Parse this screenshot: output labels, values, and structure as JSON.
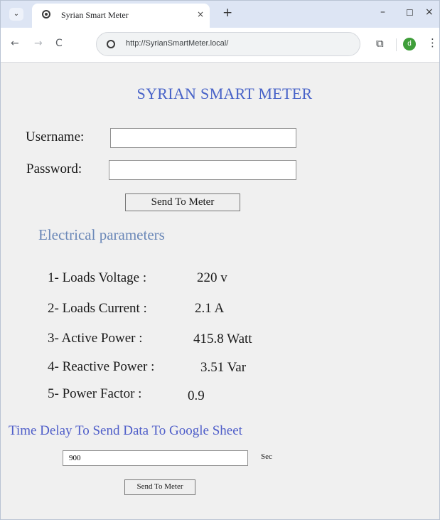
{
  "browser": {
    "tab_title": "Syrian Smart Meter",
    "tab_close": "×",
    "new_tab": "+",
    "tab_menu": "⌄",
    "url": "http://SyrianSmartMeter.local/",
    "profile_initial": "d",
    "window_controls": {
      "minimize": "–",
      "maximize": "☐",
      "close": "×"
    },
    "nav": {
      "back": "←",
      "forward": "→",
      "reload": "C"
    },
    "extensions_glyph": "⧉",
    "menu_glyph": "⋮"
  },
  "page": {
    "title": "SYRIAN SMART METER",
    "login": {
      "username_label": "Username:",
      "username_value": "",
      "password_label": "Password:",
      "password_value": "",
      "send_button": "Send To Meter"
    },
    "parameters": {
      "heading": "Electrical parameters",
      "items": [
        {
          "label": "1- Loads Voltage :",
          "value": "220 v"
        },
        {
          "label": "2- Loads Current :",
          "value": "2.1 A"
        },
        {
          "label": "3- Active Power :",
          "value": "415.8 Watt"
        },
        {
          "label": "4- Reactive Power :",
          "value": "3.51 Var"
        },
        {
          "label": "5- Power Factor :",
          "value": "0.9"
        }
      ]
    },
    "delay": {
      "heading": "Time Delay To Send Data To Google Sheet",
      "value": "900",
      "unit": "Sec",
      "send_button": "Send To Meter"
    }
  },
  "colors": {
    "title": "#4863c8",
    "section_heading": "#6b88b8",
    "delay_heading": "#4f5ec9",
    "page_background": "#f0f0f0",
    "tabstrip": "#dde5f4",
    "profile_avatar": "#3f9e3a"
  }
}
